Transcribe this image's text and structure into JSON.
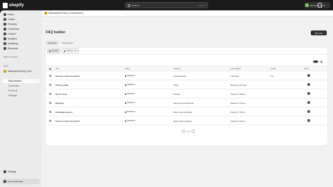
{
  "topbar": {
    "brand": "shopify",
    "search_placeholder": "Search",
    "search_shortcut": "CTRL K",
    "store_label": "Hal jewels Store"
  },
  "sidebar": {
    "items": [
      {
        "label": "Home",
        "icon": "home-icon"
      },
      {
        "label": "Orders",
        "icon": "orders-icon"
      },
      {
        "label": "Products",
        "icon": "tag-icon"
      },
      {
        "label": "Customers",
        "icon": "person-icon"
      },
      {
        "label": "Content",
        "icon": "content-icon"
      },
      {
        "label": "Analytics",
        "icon": "chart-icon"
      },
      {
        "label": "Marketing",
        "icon": "target-icon"
      },
      {
        "label": "Discounts",
        "icon": "discount-icon"
      }
    ],
    "sales_channels_label": "Sales channels",
    "apps_label": "Apps",
    "app_name": "MinimalSoft FAQ & Ins...",
    "sub_items": [
      "FAQ builder",
      "Customize",
      "Products",
      "Settings"
    ],
    "active_sub": "FAQ builder",
    "settings_label": "Settings",
    "footer_label": "Non-transferable"
  },
  "app": {
    "header_name": "MinimalSoft FAQ & Instructions",
    "page_title": "FAQ builder",
    "add_button": "Add new",
    "tabs": [
      "Questions",
      "Placeholders"
    ],
    "filters": [
      "List view",
      "Category view"
    ]
  },
  "table": {
    "columns": [
      "Title",
      "Status",
      "Category",
      "Last updated",
      "Sortby",
      "Action"
    ],
    "rows": [
      {
        "title": "How do I return my items?",
        "status": "Published",
        "category": "Uncategorized",
        "updated": "1 min ago",
        "sort": "Yes"
      },
      {
        "title": "Privacy policy",
        "status": "Published",
        "category": "Policy",
        "updated": "Monday at 8:44 am",
        "sort": ""
      },
      {
        "title": "Out of stock",
        "status": "Published",
        "category": "Product",
        "updated": "Friday at 7:35 am",
        "sort": ""
      },
      {
        "title": "Payment",
        "status": "Published",
        "category": "Payment and discounts",
        "updated": "Friday at 7:34 am",
        "sort": ""
      },
      {
        "title": "Exchange process",
        "status": "Published",
        "category": "Return and exchange",
        "updated": "Friday at 7:34 am",
        "sort": ""
      },
      {
        "title": "How do I return my items?",
        "status": "Published",
        "category": "Return and exchange",
        "updated": "Friday at 7:33 am",
        "sort": ""
      }
    ],
    "pagination": "1 / 1"
  }
}
